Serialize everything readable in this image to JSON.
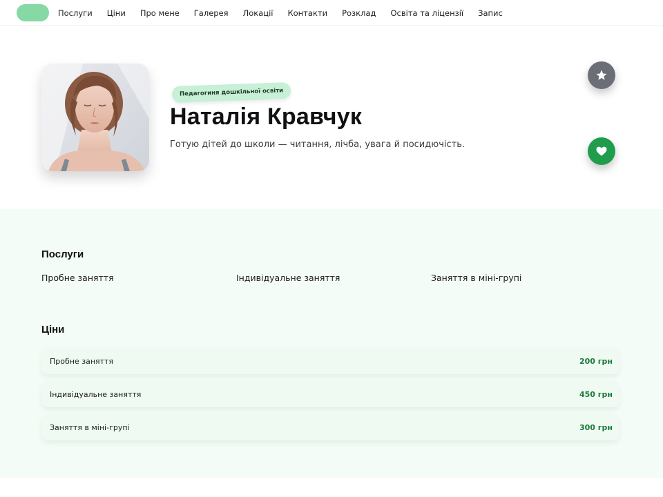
{
  "nav": {
    "items": [
      "Послуги",
      "Ціни",
      "Про мене",
      "Галерея",
      "Локації",
      "Контакти",
      "Розклад",
      "Освіта та ліцензії",
      "Запис"
    ]
  },
  "hero": {
    "tag": "Педагогиня дошкільної освіти",
    "name": "Наталія Кравчук",
    "tagline": "Готую дітей до школи — читання, лічба, увага й посидючість."
  },
  "icons": {
    "star_button": "star-icon",
    "heart_button": "heart-icon"
  },
  "colors": {
    "accent": "#1f9d4c",
    "home_pill": "#86d8a4",
    "tag_bg": "#c7f0d6",
    "star_bg": "#6b6e77",
    "price_text": "#1d7a3c",
    "section_bg": "#f4fcf7"
  },
  "services": {
    "title": "Послуги",
    "items": [
      "Пробне заняття",
      "Індивідуальне заняття",
      "Заняття в міні-групі"
    ]
  },
  "prices": {
    "title": "Ціни",
    "rows": [
      {
        "label": "Пробне заняття",
        "value": "200 грн"
      },
      {
        "label": "Індивідуальне заняття",
        "value": "450 грн"
      },
      {
        "label": "Заняття в міні-групі",
        "value": "300 грн"
      }
    ]
  }
}
